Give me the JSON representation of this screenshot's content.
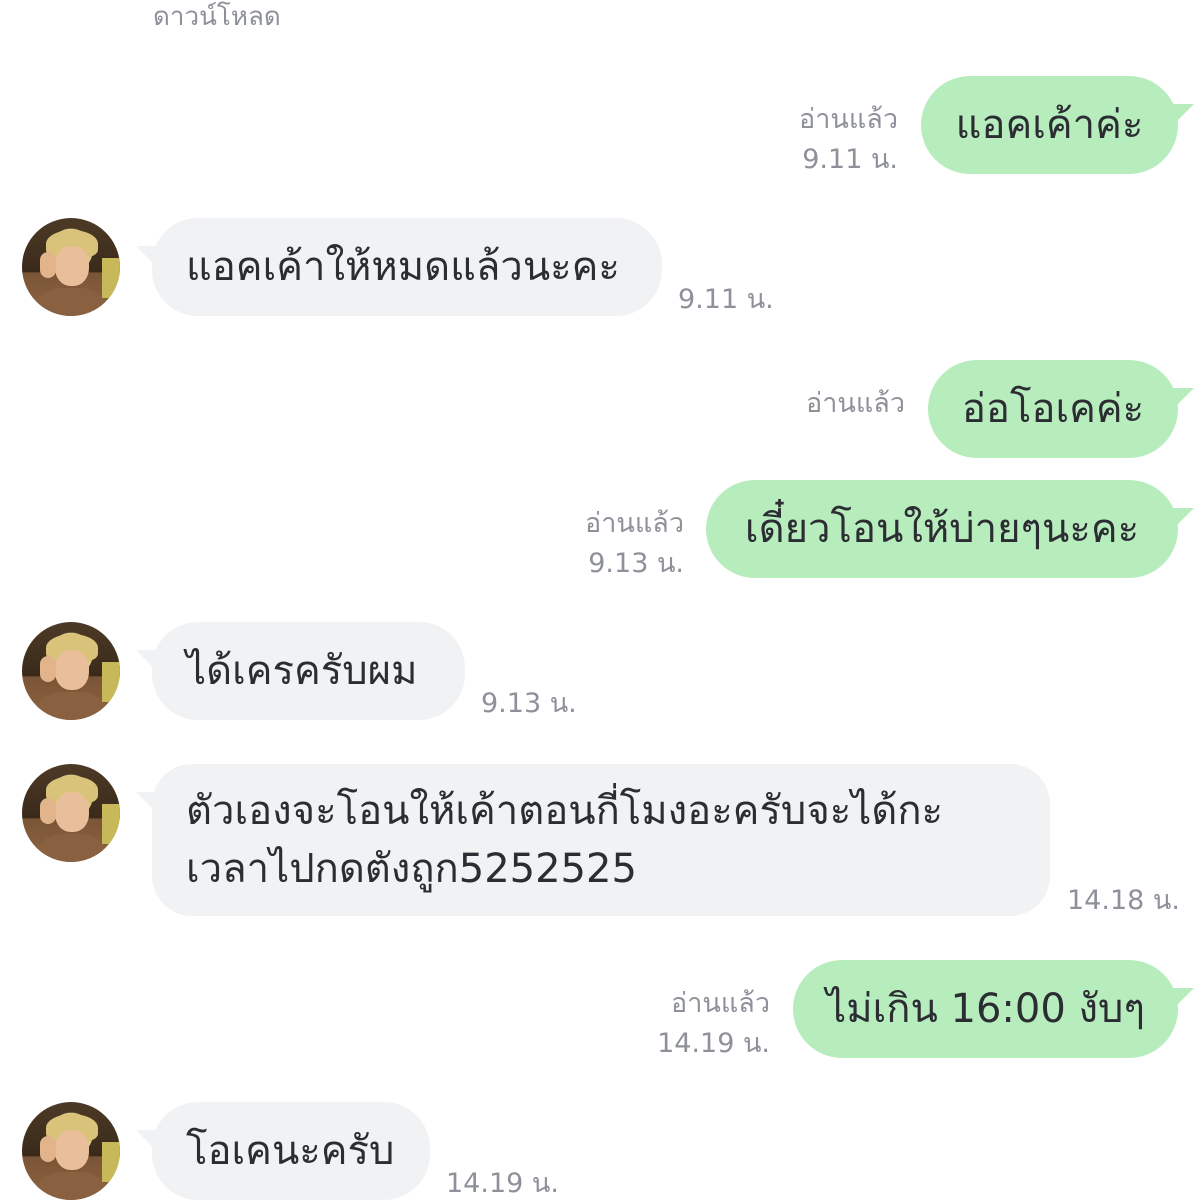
{
  "top_label": "ดาวน์โหลด",
  "messages": [
    {
      "id": "m1",
      "side": "out",
      "text": "แอคเค้าค่ะ",
      "read": "อ่านแล้ว",
      "time": "9.11 น."
    },
    {
      "id": "m2",
      "side": "in",
      "text": "แอคเค้าให้หมดแล้วนะคะ",
      "time": "9.11 น."
    },
    {
      "id": "m3",
      "side": "out",
      "text": "อ่อโอเคค่ะ",
      "read": "อ่านแล้ว",
      "time": ""
    },
    {
      "id": "m4",
      "side": "out",
      "text": "เดี๋ยวโอนให้บ่ายๆนะคะ",
      "read": "อ่านแล้ว",
      "time": "9.13 น."
    },
    {
      "id": "m5",
      "side": "in",
      "text": "ได้เครครับผม",
      "time": "9.13 น."
    },
    {
      "id": "m6",
      "side": "in",
      "lines": [
        "ตัวเองจะโอนให้เค้าตอนกี่โมงอะครับจะได้กะ",
        "เวลาไปกดตังถูก5252525"
      ],
      "time": "14.18 น."
    },
    {
      "id": "m7",
      "side": "out",
      "text": "ไม่เกิน 16:00 งับๆ",
      "read": "อ่านแล้ว",
      "time": "14.19 น."
    },
    {
      "id": "m8",
      "side": "in",
      "text": "โอเคนะครับ",
      "time": "14.19 น."
    }
  ],
  "colors": {
    "outgoing_bubble": "#b7ecbd",
    "incoming_bubble": "#f1f2f4",
    "meta_text": "#8e9199",
    "message_text": "#2b2d33"
  }
}
